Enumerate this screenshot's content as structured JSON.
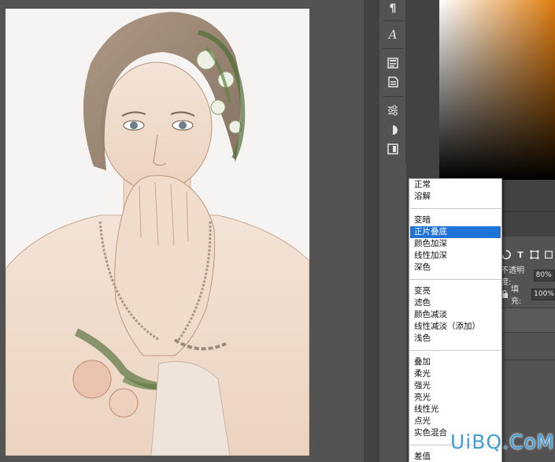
{
  "toolbar": {
    "icons": [
      "paragraph-icon",
      "character-icon",
      "paragraph-styles-icon",
      "character-styles-icon",
      "adjustments-icon",
      "styles-icon",
      "libraries-icon"
    ],
    "paragraph_glyph": "¶",
    "character_glyph": "A"
  },
  "blend_menu": {
    "selected": "正片叠底",
    "groups": [
      [
        "正常",
        "溶解"
      ],
      [
        "变暗",
        "正片叠底",
        "颜色加深",
        "线性加深",
        "深色"
      ],
      [
        "变亮",
        "滤色",
        "颜色减淡",
        "线性减淡（添加）",
        "浅色"
      ],
      [
        "叠加",
        "柔光",
        "强光",
        "亮光",
        "线性光",
        "点光",
        "实色混合"
      ],
      [
        "差值"
      ]
    ]
  },
  "layers_panel": {
    "opacity_label": "不透明度:",
    "opacity_value": "80%",
    "fill_label": "填充:",
    "fill_value": "100%",
    "filter_icons": [
      "circle-filter-icon",
      "type-filter-icon",
      "shape-filter-icon",
      "smart-object-filter-icon"
    ],
    "type_glyph": "T"
  },
  "color_picker": {
    "hue_color": "#e07d10"
  },
  "watermark": {
    "text": "UiBQ.CoM"
  }
}
